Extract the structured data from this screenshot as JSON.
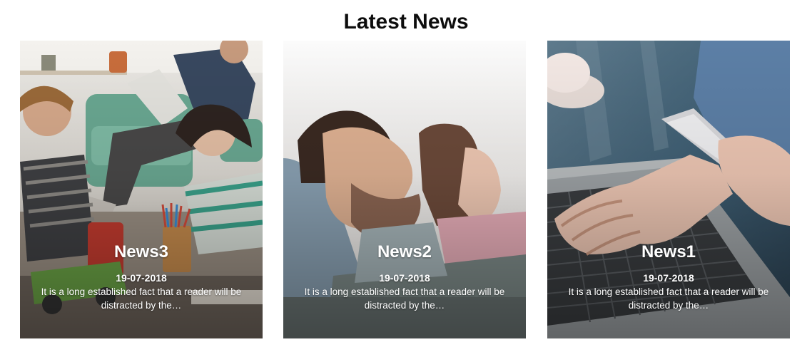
{
  "section": {
    "title": "Latest News"
  },
  "cards": [
    {
      "title": "News3",
      "date": "19-07-2018",
      "excerpt": "It is a long established fact that a reader will be distracted by the…",
      "image": "family-playing-photo"
    },
    {
      "title": "News2",
      "date": "19-07-2018",
      "excerpt": "It is a long established fact that a reader will be distracted by the…",
      "image": "couple-relaxing-photo"
    },
    {
      "title": "News1",
      "date": "19-07-2018",
      "excerpt": "It is a long established fact that a reader will be distracted by the…",
      "image": "laptop-phone-photo"
    }
  ],
  "colors": {
    "title_text": "#0d0d0d",
    "caption_text": "#ffffff",
    "background": "#ffffff"
  }
}
